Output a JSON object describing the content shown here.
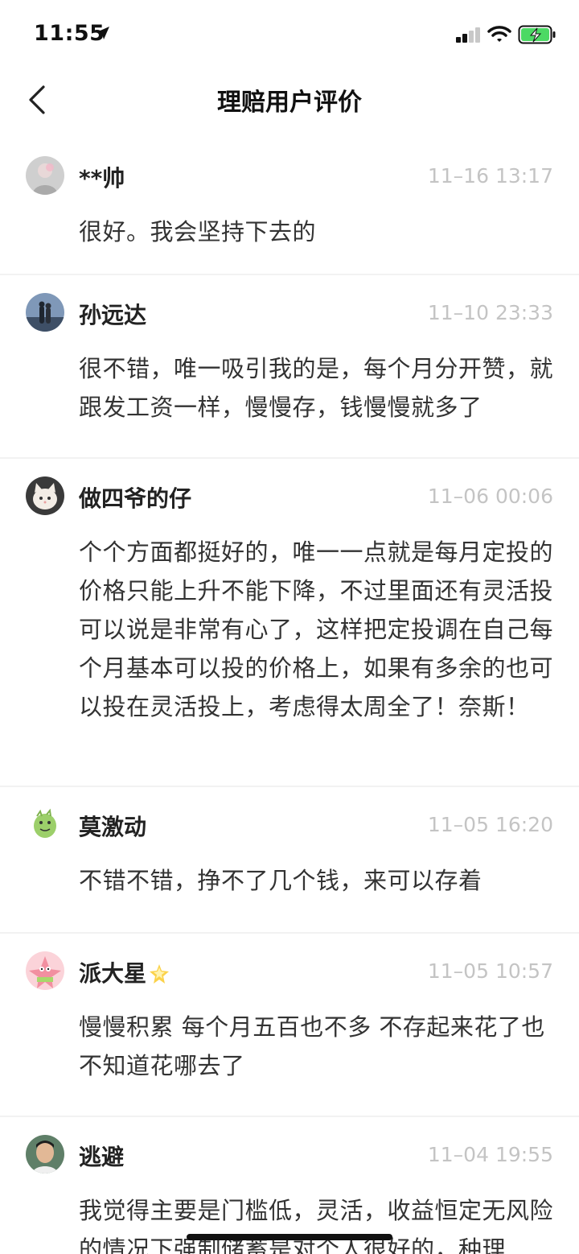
{
  "status_bar": {
    "time": "11:55",
    "icons": [
      "location-arrow-icon",
      "signal-icon",
      "wifi-icon",
      "battery-charging-icon"
    ]
  },
  "nav": {
    "title": "理赔用户评价",
    "back_icon": "chevron-left-icon"
  },
  "colors": {
    "timestamp": "#c4c4c4",
    "battery": "#4cd964",
    "divider": "#f2f2f2"
  },
  "reviews": [
    {
      "username": "**帅",
      "time": "11–16 13:17",
      "text": "很好。我会坚持下去的"
    },
    {
      "username": "孙远达",
      "time": "11–10 23:33",
      "text": "很不错，唯一吸引我的是，每个月分开赞，就跟发工资一样，慢慢存，钱慢慢就多了"
    },
    {
      "username": "做四爷的仔",
      "time": "11–06 00:06",
      "text": "个个方面都挺好的，唯一一点就是每月定投的价格只能上升不能下降，不过里面还有灵活投可以说是非常有心了，这样把定投调在自己每个月基本可以投的价格上，如果有多余的也可以投在灵活投上，考虑得太周全了！奈斯！"
    },
    {
      "username": "莫激动",
      "time": "11–05 16:20",
      "text": "不错不错，挣不了几个钱，来可以存着"
    },
    {
      "username": "派大星",
      "time": "11–05 10:57",
      "text": "慢慢积累 每个月五百也不多 不存起来花了也不知道花哪去了",
      "badge_icon": "sparkle-star-icon"
    },
    {
      "username": "逃避",
      "time": "11–04 19:55",
      "text": "我觉得主要是门槛低，灵活，收益恒定无风险的情况下强制储蓄是对个人很好的，种理"
    }
  ]
}
